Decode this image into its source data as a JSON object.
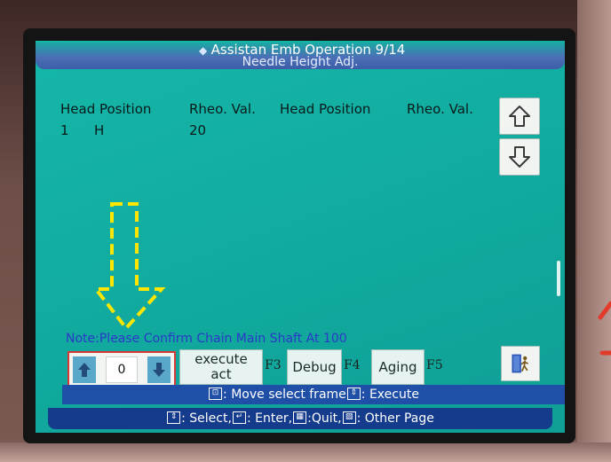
{
  "screen": {
    "title": "Assistan Emb Operation 9/14",
    "subtitle": "Needle Height Adj."
  },
  "table": {
    "headers": [
      "Head Position",
      "Rheo. Val.",
      "Head Position",
      "Rheo. Val."
    ],
    "rows": [
      {
        "index": "1",
        "head": "H",
        "value": "20"
      }
    ]
  },
  "note": "Note:Please Confirm Chain Main Shaft At 100",
  "stepper": {
    "value": "0"
  },
  "buttons": {
    "execute_line1": "execute",
    "execute_line2": "act",
    "execute_key": "F3",
    "debug": "Debug",
    "debug_key": "F4",
    "aging": "Aging",
    "aging_key": "F5"
  },
  "hint_bar": {
    "part1": ": Move select frame",
    "part2": ": Execute"
  },
  "status_bar": {
    "select": ": Select,",
    "enter": ": Enter,",
    "quit": ":Quit,",
    "other": ": Other Page"
  },
  "icons": [
    "logo-icon",
    "up-arrow-icon",
    "down-arrow-icon",
    "exit-door-icon",
    "select-key-icon",
    "enter-key-icon",
    "quit-key-icon",
    "page-key-icon",
    "move-frame-key-icon"
  ],
  "colors": {
    "screen_teal": "#12aca0",
    "title_blue": "#4b6fb6",
    "status_blue": "#143b8c",
    "note_blue": "#2b38c9",
    "stepper_border": "#d53a3a",
    "overlay_yellow": "#ffe600"
  }
}
